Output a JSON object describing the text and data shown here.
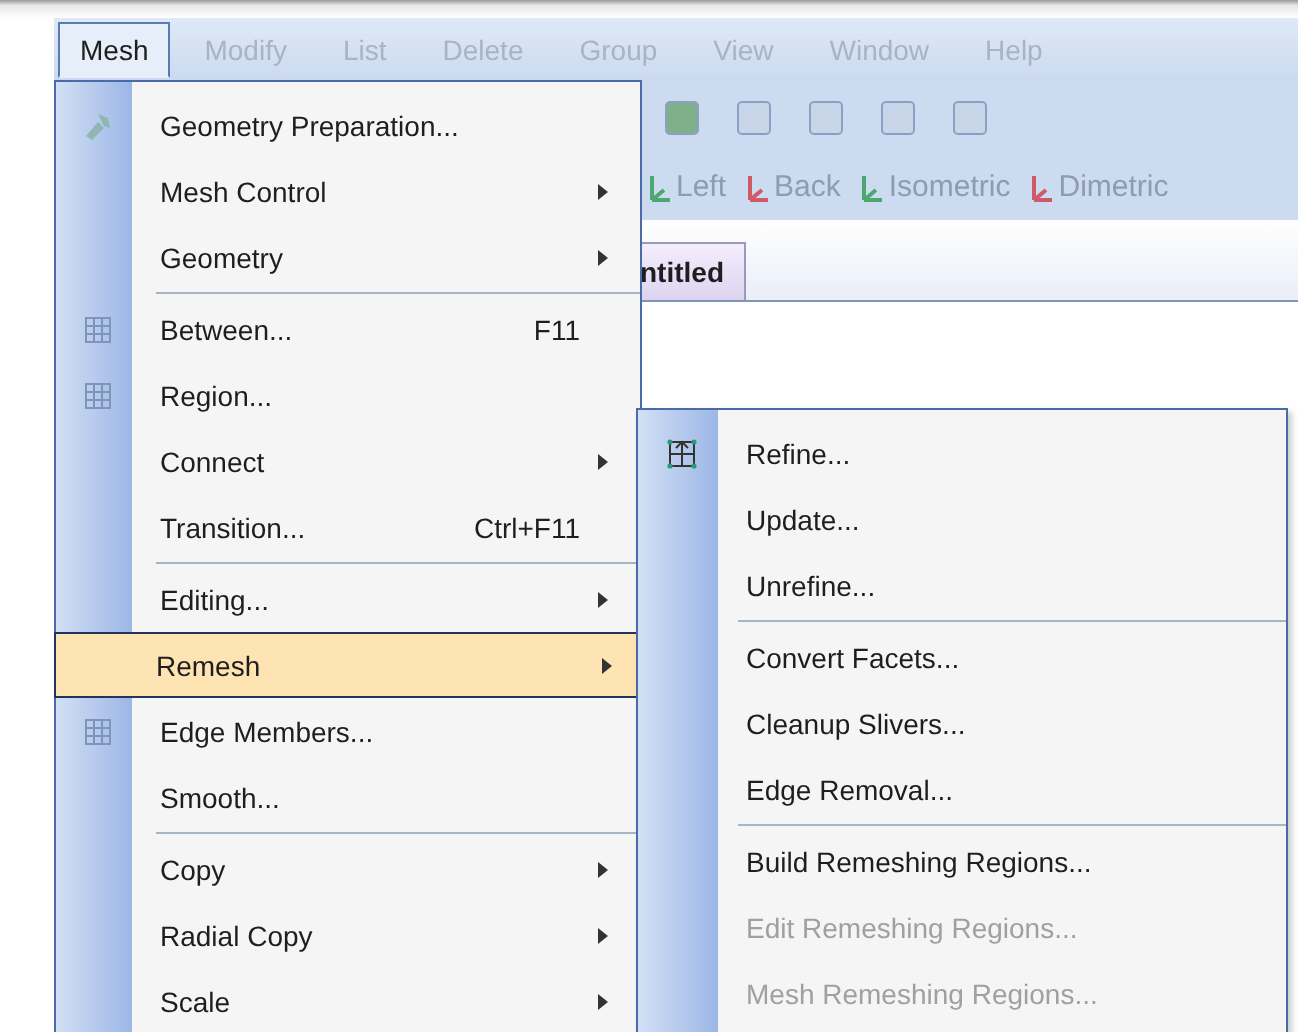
{
  "menu_bar": [
    {
      "label": "Mesh",
      "selected": true,
      "dimmed": false
    },
    {
      "label": "Modify",
      "selected": false,
      "dimmed": true
    },
    {
      "label": "List",
      "selected": false,
      "dimmed": true
    },
    {
      "label": "Delete",
      "selected": false,
      "dimmed": true
    },
    {
      "label": "Group",
      "selected": false,
      "dimmed": true
    },
    {
      "label": "View",
      "selected": false,
      "dimmed": true
    },
    {
      "label": "Window",
      "selected": false,
      "dimmed": true
    },
    {
      "label": "Help",
      "selected": false,
      "dimmed": true
    }
  ],
  "view_toolbar": [
    "Left",
    "Back",
    "Isometric",
    "Dimetric"
  ],
  "document_tab": {
    "label": "ntitled"
  },
  "menu": [
    {
      "kind": "item",
      "label": "Geometry Preparation...",
      "has_icon": true,
      "submenu": false,
      "selected": false
    },
    {
      "kind": "item",
      "label": "Mesh Control",
      "has_icon": false,
      "submenu": true,
      "selected": false
    },
    {
      "kind": "item",
      "label": "Geometry",
      "has_icon": false,
      "submenu": true,
      "selected": false
    },
    {
      "kind": "separator"
    },
    {
      "kind": "item",
      "label": "Between...",
      "shortcut": "F11",
      "has_icon": true,
      "submenu": false,
      "selected": false
    },
    {
      "kind": "item",
      "label": "Region...",
      "has_icon": true,
      "submenu": false,
      "selected": false
    },
    {
      "kind": "item",
      "label": "Connect",
      "has_icon": false,
      "submenu": true,
      "selected": false
    },
    {
      "kind": "item",
      "label": "Transition...",
      "shortcut": "Ctrl+F11",
      "has_icon": false,
      "submenu": false,
      "selected": false
    },
    {
      "kind": "separator"
    },
    {
      "kind": "item",
      "label": "Editing...",
      "has_icon": false,
      "submenu": true,
      "selected": false
    },
    {
      "kind": "item",
      "label": "Remesh",
      "has_icon": false,
      "submenu": true,
      "selected": true
    },
    {
      "kind": "item",
      "label": "Edge Members...",
      "has_icon": true,
      "submenu": false,
      "selected": false
    },
    {
      "kind": "item",
      "label": "Smooth...",
      "has_icon": false,
      "submenu": false,
      "selected": false
    },
    {
      "kind": "separator"
    },
    {
      "kind": "item",
      "label": "Copy",
      "has_icon": false,
      "submenu": true,
      "selected": false
    },
    {
      "kind": "item",
      "label": "Radial Copy",
      "has_icon": false,
      "submenu": true,
      "selected": false
    },
    {
      "kind": "item",
      "label": "Scale",
      "has_icon": false,
      "submenu": true,
      "selected": false
    }
  ],
  "submenu": [
    {
      "kind": "item",
      "label": "Refine...",
      "has_icon": true,
      "disabled": false
    },
    {
      "kind": "item",
      "label": "Update...",
      "has_icon": false,
      "disabled": false
    },
    {
      "kind": "item",
      "label": "Unrefine...",
      "has_icon": false,
      "disabled": false
    },
    {
      "kind": "separator"
    },
    {
      "kind": "item",
      "label": "Convert Facets...",
      "has_icon": false,
      "disabled": false
    },
    {
      "kind": "item",
      "label": "Cleanup Slivers...",
      "has_icon": false,
      "disabled": false
    },
    {
      "kind": "item",
      "label": "Edge Removal...",
      "has_icon": false,
      "disabled": false
    },
    {
      "kind": "separator"
    },
    {
      "kind": "item",
      "label": "Build Remeshing Regions...",
      "has_icon": false,
      "disabled": false
    },
    {
      "kind": "item",
      "label": "Edit Remeshing Regions...",
      "has_icon": false,
      "disabled": true
    },
    {
      "kind": "item",
      "label": "Mesh Remeshing Regions...",
      "has_icon": false,
      "disabled": true
    }
  ]
}
